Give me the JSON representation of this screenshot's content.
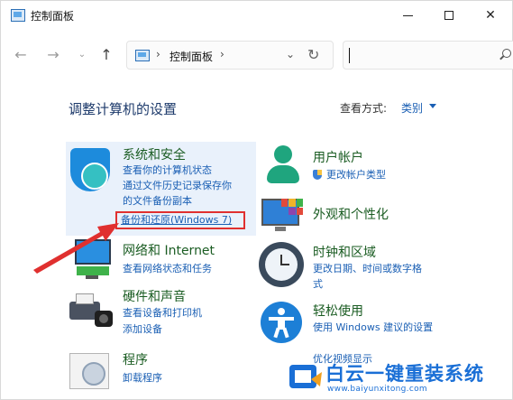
{
  "window": {
    "title": "控制面板",
    "minimize": "",
    "maximize": "",
    "close": "✕"
  },
  "nav": {
    "back": "←",
    "forward": "→",
    "history": "⌄",
    "up": "↑"
  },
  "address": {
    "sep1": "›",
    "location": "控制面板",
    "sep2": "›",
    "dropdown": "⌄",
    "refresh": "↻"
  },
  "search": {
    "placeholder": ""
  },
  "heading": "调整计算机的设置",
  "view_by": {
    "label": "查看方式:",
    "value": "类别"
  },
  "categories": {
    "system_security": {
      "title": "系统和安全",
      "links": [
        "查看你的计算机状态",
        "通过文件历史记录保存你",
        "的文件备份副本",
        "备份和还原(Windows 7)"
      ]
    },
    "user_accounts": {
      "title": "用户帐户",
      "links": [
        "更改帐户类型"
      ]
    },
    "appearance": {
      "title": "外观和个性化"
    },
    "network": {
      "title": "网络和 Internet",
      "links": [
        "查看网络状态和任务"
      ]
    },
    "clock": {
      "title": "时钟和区域",
      "links": [
        "更改日期、时间或数字格",
        "式"
      ]
    },
    "hardware": {
      "title": "硬件和声音",
      "links": [
        "查看设备和打印机",
        "添加设备"
      ]
    },
    "ease": {
      "title": "轻松使用",
      "links": [
        "使用 Windows 建议的设置",
        "优化视频显示"
      ]
    },
    "programs": {
      "title": "程序",
      "links": [
        "卸载程序"
      ]
    }
  },
  "watermark": {
    "title": "白云一键重装系统",
    "url": "www.baiyunxitong.com"
  },
  "colors": {
    "link": "#1a5fb4",
    "category_title": "#1a5c22",
    "highlight_box": "#e0302f",
    "selected_bg": "#e9f1fb"
  }
}
